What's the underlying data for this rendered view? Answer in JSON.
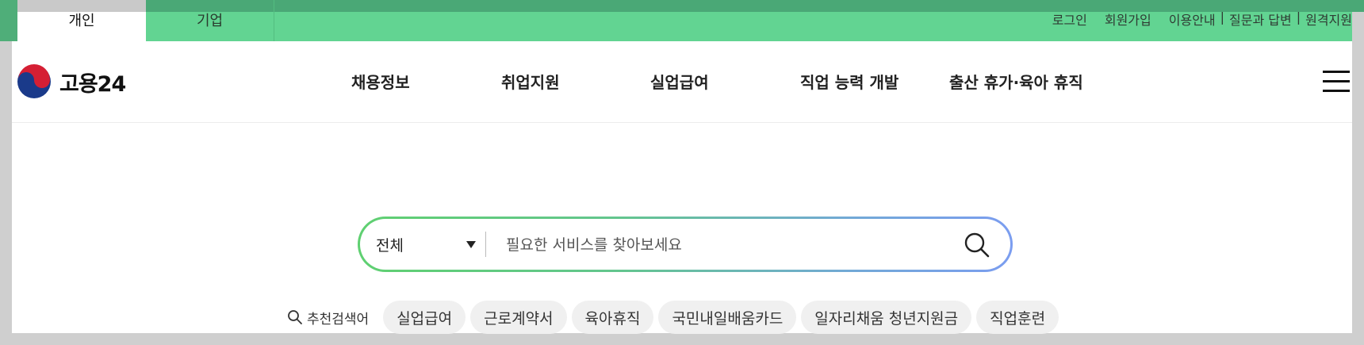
{
  "topbar": {
    "tabs": [
      {
        "label": "개인"
      },
      {
        "label": "기업"
      }
    ],
    "links": {
      "login": "로그인",
      "signup": "회원가입",
      "guide": "이용안내",
      "qna": "질문과 답변",
      "remote": "원격지원",
      "separator": "|"
    }
  },
  "header": {
    "logo_text": "고용24",
    "nav": [
      {
        "label": "채용정보"
      },
      {
        "label": "취업지원"
      },
      {
        "label": "실업급여"
      },
      {
        "label": "직업 능력 개발"
      },
      {
        "label": "출산 휴가·육아 휴직"
      }
    ]
  },
  "search": {
    "category": "전체",
    "placeholder": "필요한 서비스를 찾아보세요",
    "value": ""
  },
  "recommended": {
    "label": "추천검색어",
    "keywords": [
      "실업급여",
      "근로계약서",
      "육아휴직",
      "국민내일배움카드",
      "일자리채움 청년지원금",
      "직업훈련"
    ]
  },
  "colors": {
    "topbar_green": "#62d492",
    "search_gradient_start": "#5fd071",
    "search_gradient_end": "#7b9df0"
  },
  "icons": {
    "logo": "taeguk-logo-icon",
    "menu": "hamburger-menu-icon",
    "search": "search-icon",
    "dropdown": "caret-down-icon"
  }
}
